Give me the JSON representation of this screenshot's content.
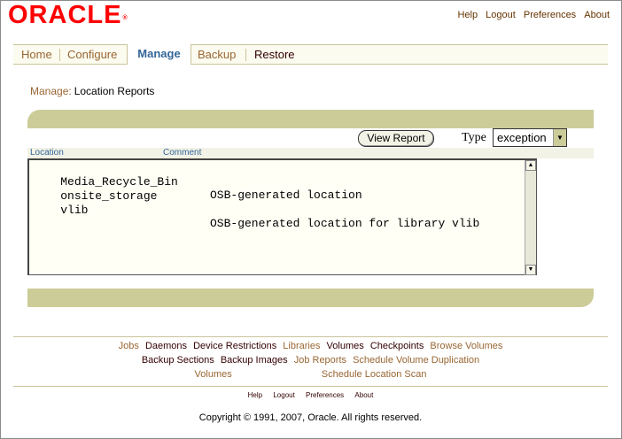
{
  "brand": {
    "logo_text": "ORACLE",
    "trademark": "®"
  },
  "global_links": [
    "Help",
    "Logout",
    "Preferences",
    "About"
  ],
  "tabs": [
    {
      "label": "Home",
      "state": "normal"
    },
    {
      "label": "Configure",
      "state": "normal"
    },
    {
      "label": "Manage",
      "state": "active"
    },
    {
      "label": "Backup",
      "state": "normal"
    },
    {
      "label": "Restore",
      "state": "dark"
    }
  ],
  "breadcrumb": {
    "parent": "Manage:",
    "current": "Location Reports"
  },
  "controls": {
    "view_report_label": "View Report",
    "type_label": "Type",
    "type_value": "exception"
  },
  "report": {
    "columns": [
      "Location",
      "Comment"
    ],
    "rows": [
      {
        "location": "Media_Recycle_Bin",
        "comment": "OSB-generated location"
      },
      {
        "location": "onsite_storage",
        "comment": ""
      },
      {
        "location": "vlib",
        "comment": "OSB-generated location for library vlib"
      }
    ]
  },
  "footer": {
    "row1": [
      {
        "label": "Jobs",
        "tone": "tan"
      },
      {
        "label": "Daemons",
        "tone": "dark"
      },
      {
        "label": "Device Restrictions",
        "tone": "dark"
      },
      {
        "label": "Libraries",
        "tone": "tan"
      },
      {
        "label": "Volumes",
        "tone": "dark"
      },
      {
        "label": "Checkpoints",
        "tone": "dark"
      },
      {
        "label": "Browse Volumes",
        "tone": "tan"
      }
    ],
    "row2": [
      {
        "label": "Backup Sections",
        "tone": "dark"
      },
      {
        "label": "Backup Images",
        "tone": "dark"
      },
      {
        "label": "Job Reports",
        "tone": "tan"
      },
      {
        "label": "Schedule Volume Duplication",
        "tone": "tan"
      }
    ],
    "row3": [
      {
        "label": "Volumes",
        "tone": "tan"
      },
      {
        "label": "Schedule Location Scan",
        "tone": "tan"
      }
    ],
    "global_links": [
      "Help",
      "Logout",
      "Preferences",
      "About"
    ],
    "copyright": "Copyright © 1991, 2007, Oracle. All rights reserved."
  },
  "colors": {
    "brand_red": "#ff0000",
    "olive_bar": "#cccc99",
    "link_tan": "#996633",
    "link_dark": "#330000",
    "active_tab": "#336699"
  }
}
